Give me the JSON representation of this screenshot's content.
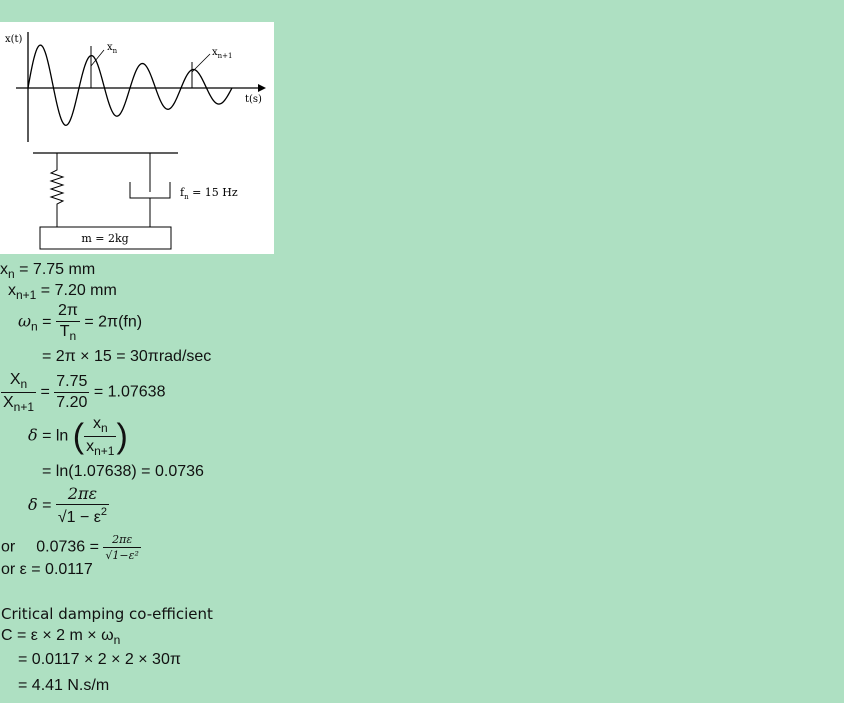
{
  "figure": {
    "y_axis_label": "x(t)",
    "x_axis_label": "t(s)",
    "peak_label_n": "x",
    "peak_label_n_sub": "n",
    "peak_label_n1": "x",
    "peak_label_n1_sub": "n+1",
    "fn_label": "f",
    "fn_sub": "n",
    "fn_value": " = 15 Hz",
    "mass_label": "m = 2kg"
  },
  "solution": {
    "l1_var": "x",
    "l1_sub": "n",
    "l1_rest": " = 7.75 mm",
    "l2_var": "x",
    "l2_sub": "n+1",
    "l2_rest": " = 7.20 mm",
    "l3_lhs": "ω",
    "l3_lhs_sub": "n",
    "l3_eq": " = ",
    "l3_num": "2π",
    "l3_den": "T",
    "l3_den_sub": "n",
    "l3_rest": " = 2π(fn)",
    "l4_text": "= 2π × 15 = 30πrad/sec",
    "l5_num": "X",
    "l5_num_sub": "n",
    "l5_den": "X",
    "l5_den_sub": "n+1",
    "l5_eq": " = ",
    "l5_num2": "7.75",
    "l5_den2": "7.20",
    "l5_rest": " = 1.07638",
    "l6_lhs": "δ",
    "l6_eq": " = ln ",
    "l6_num": "x",
    "l6_num_sub": "n",
    "l6_den": "x",
    "l6_den_sub": "n+1",
    "l7_text": "= ln(1.07638) = 0.0736",
    "l8_lhs": "δ",
    "l8_eq": " = ",
    "l8_num": "2πε",
    "l8_den": "√1 − ε",
    "l8_den_sup": "2",
    "l9_or": "or",
    "l9_val": "0.0736 = ",
    "l9_num": "2πε",
    "l9_den": "√1−ε²",
    "l10_text": "or ε = 0.0117",
    "heading": "Critical damping co-efficient",
    "l11_text": "C = ε × 2 m × ω",
    "l11_sub": "n",
    "l12_text": "= 0.0117 × 2 × 2 × 30π",
    "l13_text": "= 4.41 N.s/m"
  }
}
